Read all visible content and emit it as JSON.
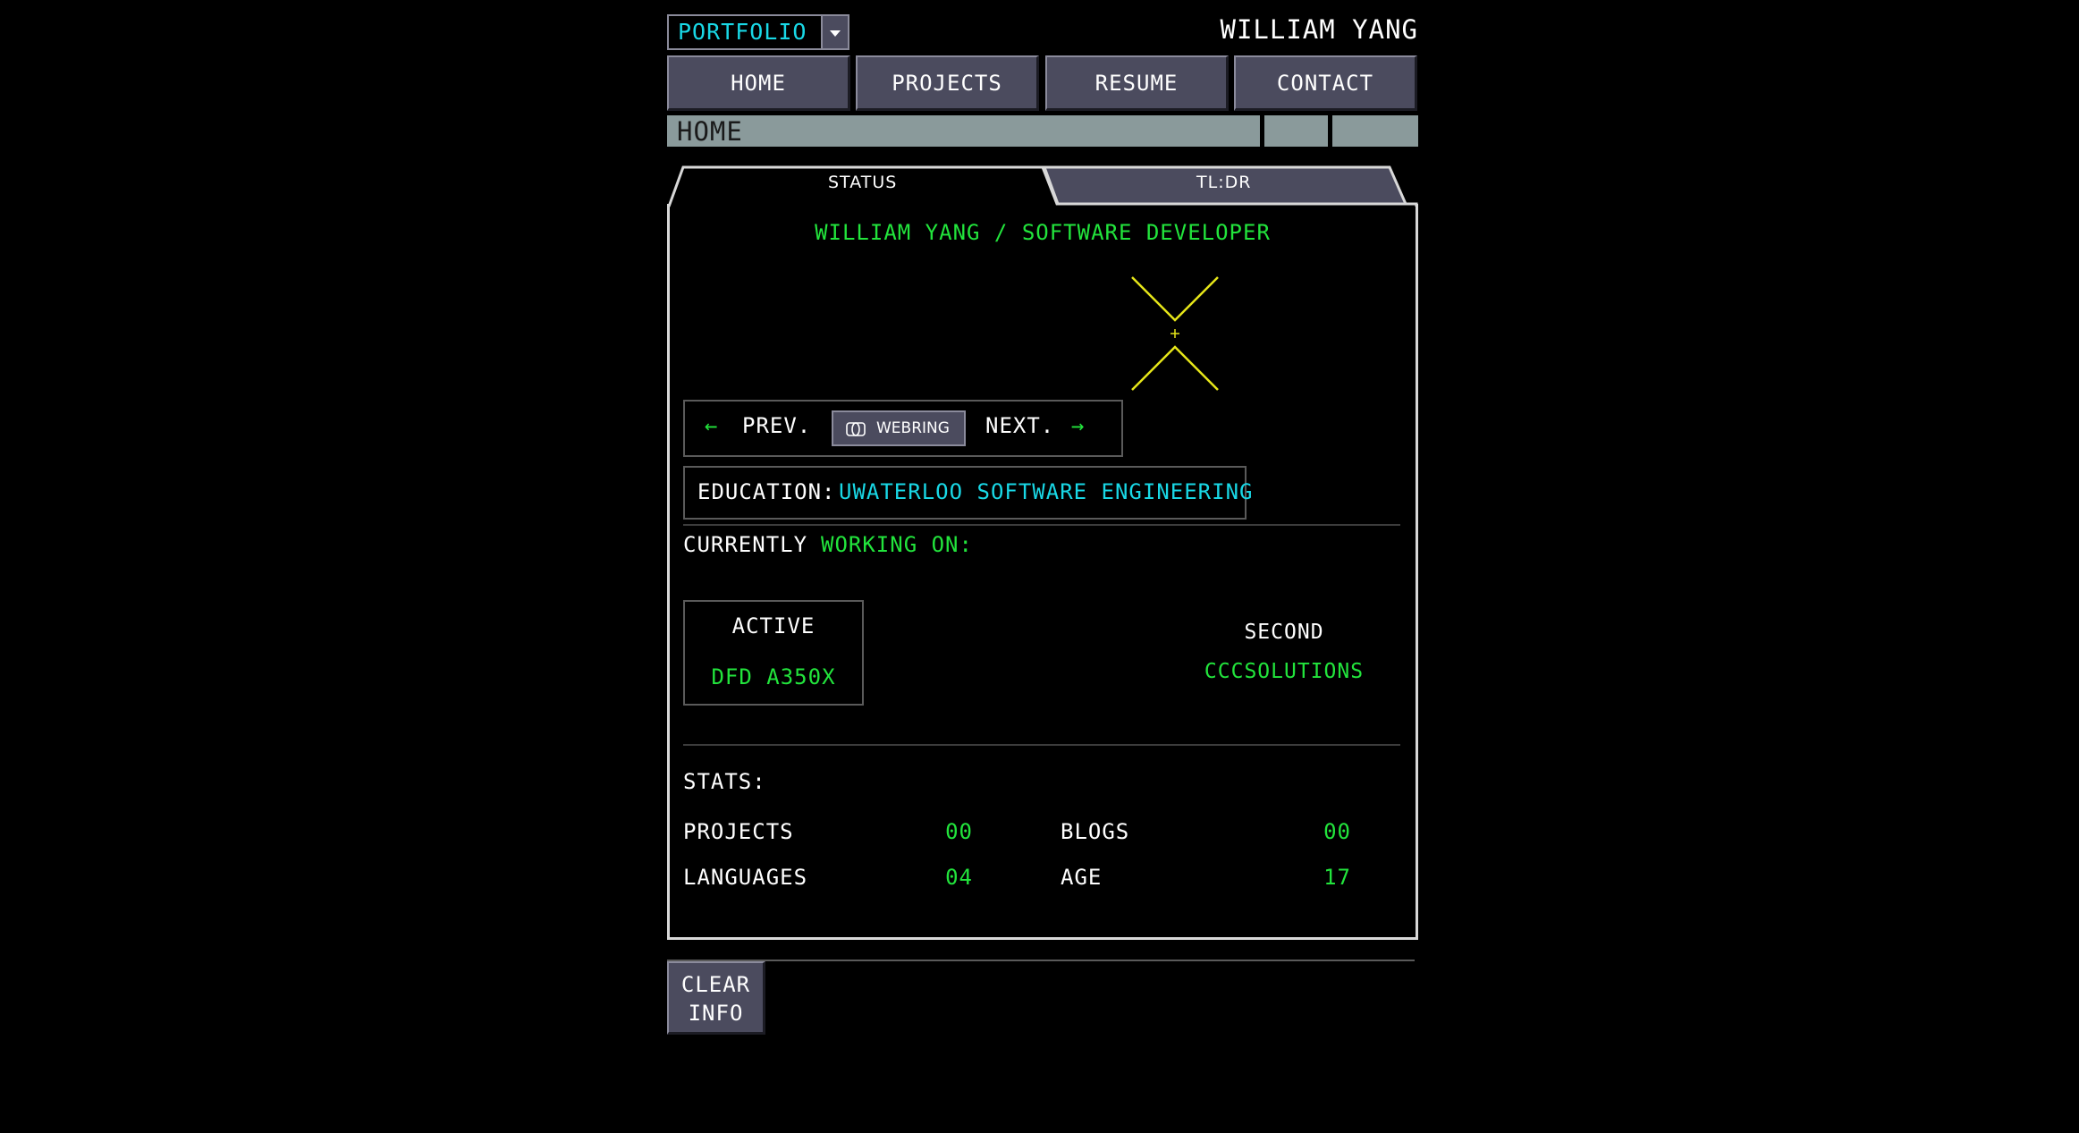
{
  "header": {
    "select_value": "PORTFOLIO",
    "owner": "WILLIAM YANG"
  },
  "nav": {
    "items": [
      {
        "label": "HOME"
      },
      {
        "label": "PROJECTS"
      },
      {
        "label": "RESUME"
      },
      {
        "label": "CONTACT"
      }
    ]
  },
  "breadcrumb": {
    "current": "HOME"
  },
  "tabs": [
    {
      "label": "STATUS",
      "active": true
    },
    {
      "label": "TL:DR",
      "active": false
    }
  ],
  "status": {
    "headline": "WILLIAM YANG / SOFTWARE DEVELOPER",
    "webring": {
      "prev_arrow": "←",
      "prev_label": "PREV.",
      "button_label": "WEBRING",
      "next_label": "NEXT.",
      "next_arrow": "→"
    },
    "education": {
      "label": "EDUCATION:",
      "value": "UWATERLOO SOFTWARE ENGINEERING"
    },
    "currently": {
      "label": "CURRENTLY",
      "label_green": "WORKING ON:",
      "active": {
        "title": "ACTIVE",
        "value": "DFD A350X"
      },
      "second": {
        "title": "SECOND",
        "value": "CCCSOLUTIONS"
      }
    },
    "stats": {
      "title": "STATS:",
      "items": [
        {
          "label": "PROJECTS",
          "value": "00"
        },
        {
          "label": "BLOGS",
          "value": "00"
        },
        {
          "label": "LANGUAGES",
          "value": "04"
        },
        {
          "label": "AGE",
          "value": "17"
        }
      ]
    }
  },
  "footer": {
    "clear_line1": "CLEAR",
    "clear_line2": "INFO"
  },
  "colors": {
    "green": "#22e43c",
    "cyan": "#19d8e6",
    "yellow": "#e6e619",
    "button": "#4b4b5e"
  }
}
